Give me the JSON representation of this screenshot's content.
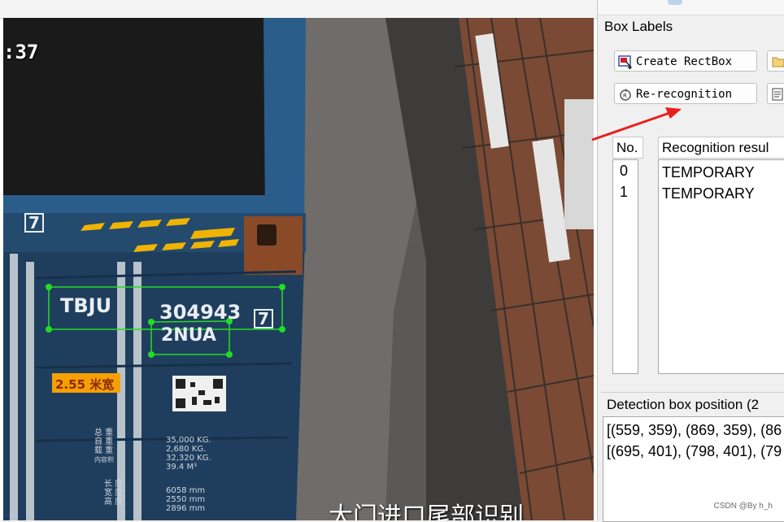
{
  "viewer": {
    "timestamp": ":37",
    "caption": "大门进口尾部识别",
    "container": {
      "owner_code": "TBJU",
      "serial": "304943",
      "check_digit": "7",
      "type_code": "2NUA",
      "top_check": "7",
      "width_label": "2.55 米宽",
      "weights": {
        "labels": [
          "总 重",
          "自 重",
          "载 重",
          "内容积"
        ],
        "values": [
          "35,000 KG.",
          "2,680 KG.",
          "32,320 KG.",
          "39.4 M³"
        ]
      },
      "dimensions": {
        "labels": [
          "长 度",
          "宽 度",
          "高 度"
        ],
        "values": [
          "6058 mm",
          "2550 mm",
          "2896 mm"
        ]
      }
    }
  },
  "panel": {
    "box_labels_title": "Box Labels",
    "create_rectbox_label": "Create RectBox",
    "rerecognition_label": "Re-recognition",
    "table": {
      "columns": [
        "No.",
        "Recognition resul"
      ],
      "rows": [
        {
          "no": "0",
          "text": "TEMPORARY"
        },
        {
          "no": "1",
          "text": "TEMPORARY"
        }
      ]
    },
    "detection_title": "Detection box position (2",
    "positions": [
      "[(559, 359), (869, 359), (86",
      "[(695, 401), (798, 401), (79"
    ]
  },
  "watermark": "CSDN @By h_h",
  "colors": {
    "detection_box": "#22dd22",
    "arrow": "#e8201c",
    "container_blue": "#1e3d5c"
  }
}
